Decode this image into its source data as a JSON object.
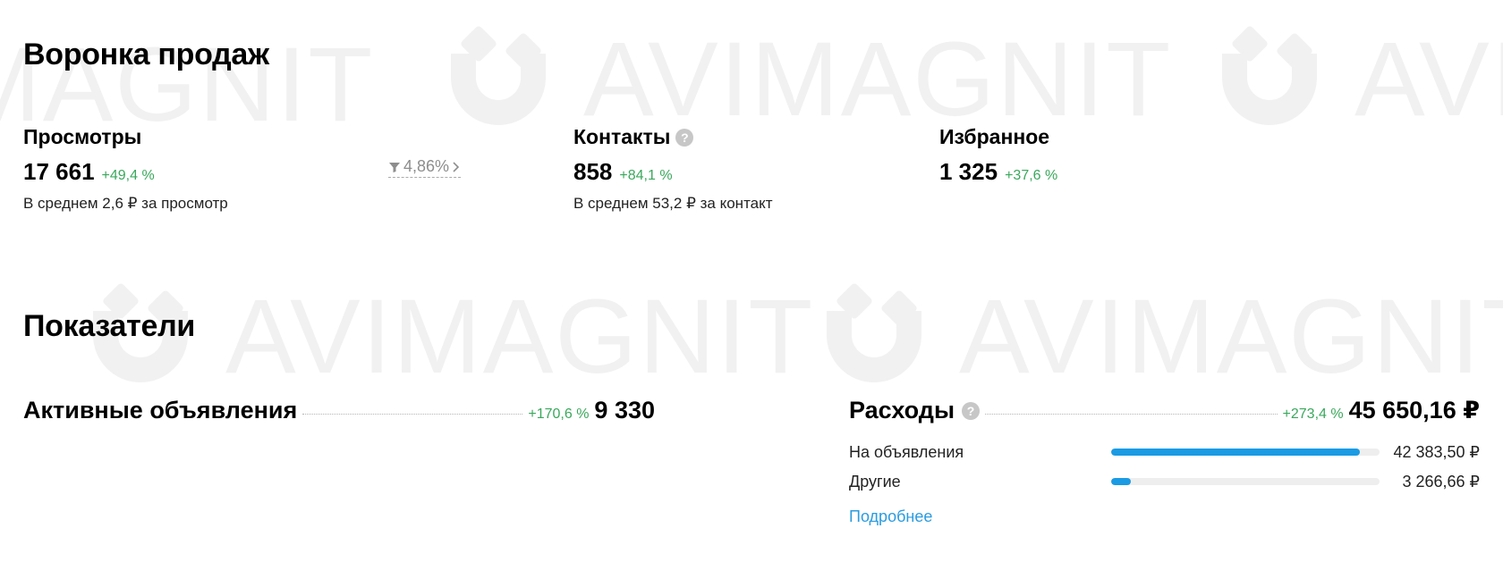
{
  "watermark": {
    "text": "AVIMAGNIT"
  },
  "funnel": {
    "title": "Воронка продаж",
    "views": {
      "label": "Просмотры",
      "value": "17 661",
      "change": "+49,4 %",
      "note": "В среднем 2,6 ₽ за просмотр"
    },
    "conversion": {
      "value": "4,86%",
      "icon": "filter-icon",
      "arrow": "chevron-right-icon"
    },
    "contacts": {
      "label": "Контакты",
      "value": "858",
      "change": "+84,1 %",
      "note": "В среднем 53,2 ₽ за контакт",
      "help_icon": "question-icon"
    },
    "favorites": {
      "label": "Избранное",
      "value": "1 325",
      "change": "+37,6 %"
    }
  },
  "metrics": {
    "title": "Показатели",
    "active_ads": {
      "label": "Активные объявления",
      "change": "+170,6 %",
      "value": "9 330"
    },
    "expenses": {
      "label": "Расходы",
      "help_icon": "question-icon",
      "change": "+273,4 %",
      "value": "45 650,16 ₽",
      "items": [
        {
          "label": "На объявления",
          "value": "42 383,50 ₽",
          "share": 0.928
        },
        {
          "label": "Другие",
          "value": "3 266,66 ₽",
          "share": 0.072
        }
      ],
      "more_link": "Подробнее"
    }
  },
  "colors": {
    "positive": "#3aa85c",
    "bar": "#1a9be4",
    "link": "#2a9ce0"
  }
}
